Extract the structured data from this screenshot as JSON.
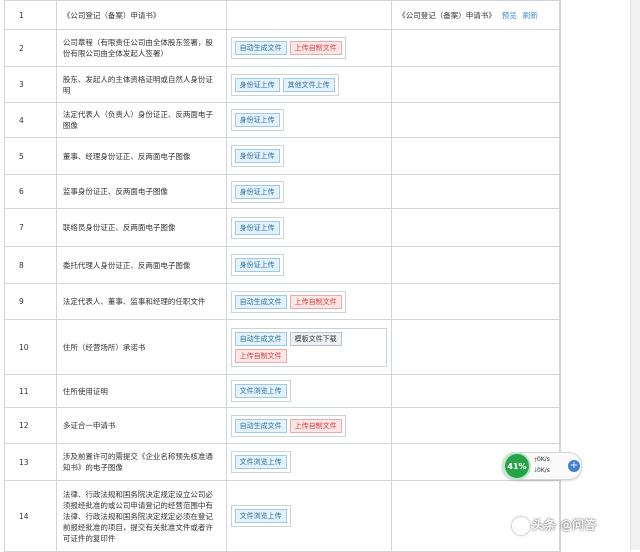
{
  "rows": [
    {
      "num": "1",
      "name": "《公司登记（备案）申请书》",
      "buttons": [],
      "extra": "《公司登记（备案）申请书》",
      "links": [
        "预览",
        "刷新"
      ],
      "h": 28
    },
    {
      "num": "2",
      "name": "公司章程（有限责任公司由全体股东签署，股份有限公司由全体发起人签署）",
      "buttons": [
        {
          "label": "自动生成文件",
          "style": "blue"
        },
        {
          "label": "上传自制文件",
          "style": "red"
        }
      ],
      "h": 36
    },
    {
      "num": "3",
      "name": "股东、发起人的主体资格证明或自然人身份证明",
      "buttons": [
        {
          "label": "身份证上传",
          "style": "blue"
        },
        {
          "label": "其他文件上传",
          "style": "blue"
        }
      ],
      "h": 35
    },
    {
      "num": "4",
      "name": "法定代表人（负责人）身份证正、反两面电子图像",
      "buttons": [
        {
          "label": "身份证上传",
          "style": "blue"
        }
      ],
      "h": 34
    },
    {
      "num": "5",
      "name": "董事、经理身份证正、反两面电子图像",
      "buttons": [
        {
          "label": "身份证上传",
          "style": "blue"
        }
      ],
      "h": 36
    },
    {
      "num": "6",
      "name": "监事身份证正、反两面电子图像",
      "buttons": [
        {
          "label": "身份证上传",
          "style": "blue"
        }
      ],
      "h": 33
    },
    {
      "num": "7",
      "name": "联络员身份证正、反两面电子图像",
      "buttons": [
        {
          "label": "身份证上传",
          "style": "blue"
        }
      ],
      "h": 37
    },
    {
      "num": "8",
      "name": "委托代理人身份证正、反两面电子图像",
      "buttons": [
        {
          "label": "身份证上传",
          "style": "blue"
        }
      ],
      "h": 36
    },
    {
      "num": "9",
      "name": "法定代表人、董事、监事和经理的任职文件",
      "buttons": [
        {
          "label": "自动生成文件",
          "style": "blue"
        },
        {
          "label": "上传自制文件",
          "style": "red"
        }
      ],
      "h": 35
    },
    {
      "num": "10",
      "name": "住所（经营场所）承诺书",
      "buttons": [
        {
          "label": "自动生成文件",
          "style": "blue"
        },
        {
          "label": "模板文件下载",
          "style": "gray"
        },
        {
          "label": "上传自制文件",
          "style": "red"
        }
      ],
      "h": 54
    },
    {
      "num": "11",
      "name": "住所使用证明",
      "buttons": [
        {
          "label": "文件浏览上传",
          "style": "blue"
        }
      ],
      "h": 32
    },
    {
      "num": "12",
      "name": "多证合一申请书",
      "buttons": [
        {
          "label": "自动生成文件",
          "style": "blue"
        },
        {
          "label": "上传自制文件",
          "style": "red"
        }
      ],
      "h": 35
    },
    {
      "num": "13",
      "name": "涉及前置许可的需提交《企业名称预先核准通知书》的电子图像",
      "buttons": [
        {
          "label": "文件浏览上传",
          "style": "blue"
        }
      ],
      "h": 36
    },
    {
      "num": "14",
      "name": "法律、行政法规和国务院决定规定设立公司必须报经批准的或公司申请登记的经营范围中有法律、行政法规和国务院决定规定必须在登记前报经批准的项目，提交有关批准文件或者许可证件的复印件",
      "buttons": [
        {
          "label": "文件浏览上传",
          "style": "blue"
        }
      ],
      "h": 70
    }
  ],
  "widget": {
    "percent": "41%",
    "up": "0K/s",
    "down": "0K/s",
    "plus": "+"
  },
  "watermark": "头条 @问答"
}
